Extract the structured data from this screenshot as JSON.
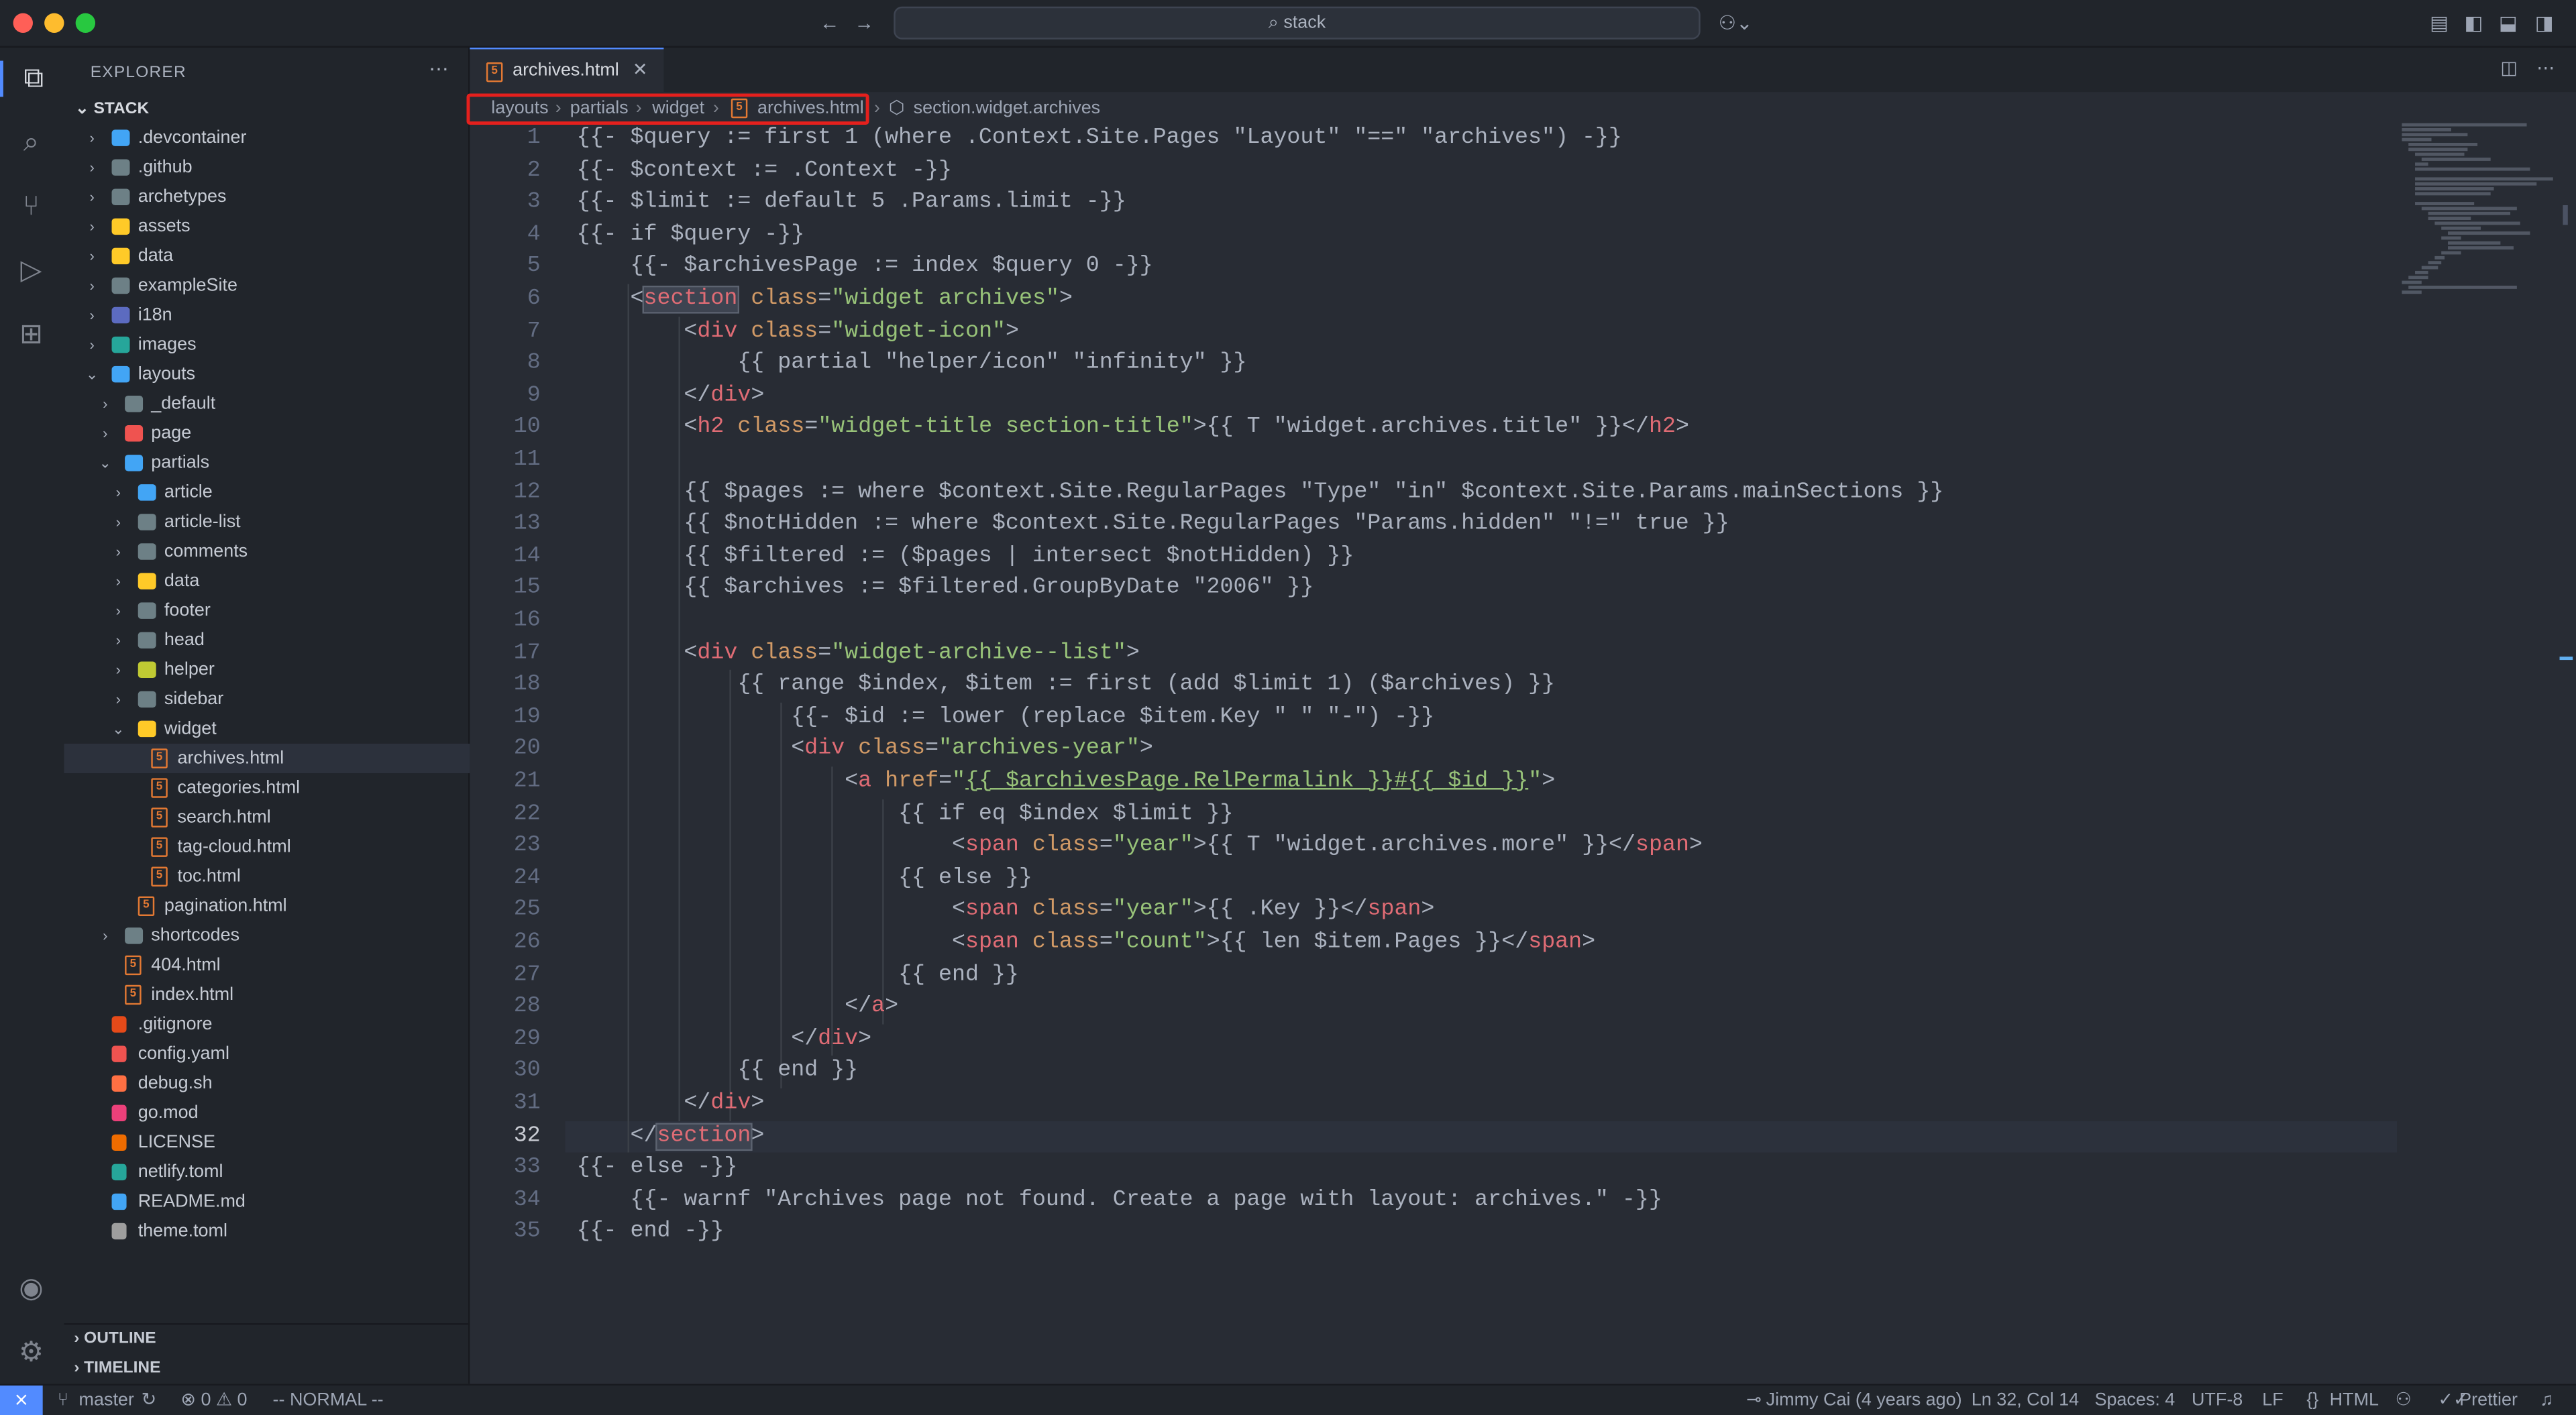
{
  "window": {
    "search_text": "stack"
  },
  "sidebar": {
    "explorer_title": "EXPLORER",
    "root_label": "STACK",
    "outline_label": "OUTLINE",
    "timeline_label": "TIMELINE",
    "tree": [
      {
        "label": ".devcontainer",
        "kind": "folder",
        "depth": 1,
        "chevron": "›",
        "color": "#42a5f5"
      },
      {
        "label": ".github",
        "kind": "folder",
        "depth": 1,
        "chevron": "›",
        "color": "#6d8086"
      },
      {
        "label": "archetypes",
        "kind": "folder",
        "depth": 1,
        "chevron": "›",
        "color": "#6d8086"
      },
      {
        "label": "assets",
        "kind": "folder",
        "depth": 1,
        "chevron": "›",
        "color": "#ffca28"
      },
      {
        "label": "data",
        "kind": "folder",
        "depth": 1,
        "chevron": "›",
        "color": "#ffca28"
      },
      {
        "label": "exampleSite",
        "kind": "folder",
        "depth": 1,
        "chevron": "›",
        "color": "#6d8086"
      },
      {
        "label": "i18n",
        "kind": "folder",
        "depth": 1,
        "chevron": "›",
        "color": "#5c6bc0"
      },
      {
        "label": "images",
        "kind": "folder",
        "depth": 1,
        "chevron": "›",
        "color": "#26a69a"
      },
      {
        "label": "layouts",
        "kind": "folder",
        "depth": 1,
        "chevron": "⌄",
        "color": "#42a5f5"
      },
      {
        "label": "_default",
        "kind": "folder",
        "depth": 2,
        "chevron": "›",
        "color": "#6d8086"
      },
      {
        "label": "page",
        "kind": "folder",
        "depth": 2,
        "chevron": "›",
        "color": "#ef5350"
      },
      {
        "label": "partials",
        "kind": "folder",
        "depth": 2,
        "chevron": "⌄",
        "color": "#42a5f5"
      },
      {
        "label": "article",
        "kind": "folder",
        "depth": 3,
        "chevron": "›",
        "color": "#42a5f5"
      },
      {
        "label": "article-list",
        "kind": "folder",
        "depth": 3,
        "chevron": "›",
        "color": "#6d8086"
      },
      {
        "label": "comments",
        "kind": "folder",
        "depth": 3,
        "chevron": "›",
        "color": "#6d8086"
      },
      {
        "label": "data",
        "kind": "folder",
        "depth": 3,
        "chevron": "›",
        "color": "#ffca28"
      },
      {
        "label": "footer",
        "kind": "folder",
        "depth": 3,
        "chevron": "›",
        "color": "#6d8086"
      },
      {
        "label": "head",
        "kind": "folder",
        "depth": 3,
        "chevron": "›",
        "color": "#6d8086"
      },
      {
        "label": "helper",
        "kind": "folder",
        "depth": 3,
        "chevron": "›",
        "color": "#c0ca33"
      },
      {
        "label": "sidebar",
        "kind": "folder",
        "depth": 3,
        "chevron": "›",
        "color": "#6d8086"
      },
      {
        "label": "widget",
        "kind": "folder",
        "depth": 3,
        "chevron": "⌄",
        "color": "#ffca28"
      },
      {
        "label": "archives.html",
        "kind": "html",
        "depth": 4,
        "chevron": "",
        "color": "#e37933"
      },
      {
        "label": "categories.html",
        "kind": "html",
        "depth": 4,
        "chevron": "",
        "color": "#e37933"
      },
      {
        "label": "search.html",
        "kind": "html",
        "depth": 4,
        "chevron": "",
        "color": "#e37933"
      },
      {
        "label": "tag-cloud.html",
        "kind": "html",
        "depth": 4,
        "chevron": "",
        "color": "#e37933"
      },
      {
        "label": "toc.html",
        "kind": "html",
        "depth": 4,
        "chevron": "",
        "color": "#e37933"
      },
      {
        "label": "pagination.html",
        "kind": "html",
        "depth": 3,
        "chevron": "",
        "color": "#e37933"
      },
      {
        "label": "shortcodes",
        "kind": "folder",
        "depth": 2,
        "chevron": "›",
        "color": "#6d8086"
      },
      {
        "label": "404.html",
        "kind": "html",
        "depth": 2,
        "chevron": "",
        "color": "#e37933"
      },
      {
        "label": "index.html",
        "kind": "html",
        "depth": 2,
        "chevron": "",
        "color": "#e37933"
      },
      {
        "label": ".gitignore",
        "kind": "file",
        "depth": 1,
        "chevron": "",
        "color": "#e64a19"
      },
      {
        "label": "config.yaml",
        "kind": "file",
        "depth": 1,
        "chevron": "",
        "color": "#ef5350"
      },
      {
        "label": "debug.sh",
        "kind": "file",
        "depth": 1,
        "chevron": "",
        "color": "#ff7043"
      },
      {
        "label": "go.mod",
        "kind": "file",
        "depth": 1,
        "chevron": "",
        "color": "#ec407a"
      },
      {
        "label": "LICENSE",
        "kind": "file",
        "depth": 1,
        "chevron": "",
        "color": "#ef6c00"
      },
      {
        "label": "netlify.toml",
        "kind": "file",
        "depth": 1,
        "chevron": "",
        "color": "#26a69a"
      },
      {
        "label": "README.md",
        "kind": "file",
        "depth": 1,
        "chevron": "",
        "color": "#42a5f5"
      },
      {
        "label": "theme.toml",
        "kind": "file",
        "depth": 1,
        "chevron": "",
        "color": "#9e9e9e"
      }
    ]
  },
  "editor": {
    "tab_label": "archives.html",
    "breadcrumb": [
      "layouts",
      "partials",
      "widget",
      "archives.html",
      "section.widget.archives"
    ],
    "current_line": 32,
    "lines": [
      "{{- $query := first 1 (where .Context.Site.Pages \"Layout\" \"==\" \"archives\") -}}",
      "{{- $context := .Context -}}",
      "{{- $limit := default 5 .Params.limit -}}",
      "{{- if $query -}}",
      "    {{- $archivesPage := index $query 0 -}}",
      "    <section class=\"widget archives\">",
      "        <div class=\"widget-icon\">",
      "            {{ partial \"helper/icon\" \"infinity\" }}",
      "        </div>",
      "        <h2 class=\"widget-title section-title\">{{ T \"widget.archives.title\" }}</h2>",
      "",
      "        {{ $pages := where $context.Site.RegularPages \"Type\" \"in\" $context.Site.Params.mainSections }}",
      "        {{ $notHidden := where $context.Site.RegularPages \"Params.hidden\" \"!=\" true }}",
      "        {{ $filtered := ($pages | intersect $notHidden) }}",
      "        {{ $archives := $filtered.GroupByDate \"2006\" }}",
      "",
      "        <div class=\"widget-archive--list\">",
      "            {{ range $index, $item := first (add $limit 1) ($archives) }}",
      "                {{- $id := lower (replace $item.Key \" \" \"-\") -}}",
      "                <div class=\"archives-year\">",
      "                    <a href=\"{{ $archivesPage.RelPermalink }}#{{ $id }}\">",
      "                        {{ if eq $index $limit }}",
      "                            <span class=\"year\">{{ T \"widget.archives.more\" }}</span>",
      "                        {{ else }}",
      "                            <span class=\"year\">{{ .Key }}</span>",
      "                            <span class=\"count\">{{ len $item.Pages }}</span>",
      "                        {{ end }}",
      "                    </a>",
      "                </div>",
      "            {{ end }}",
      "        </div>",
      "    </section>",
      "{{- else -}}",
      "    {{- warnf \"Archives page not found. Create a page with layout: archives.\" -}}",
      "{{- end -}}"
    ]
  },
  "status": {
    "branch": "master",
    "problems": "⊗ 0 ⚠ 0",
    "mode": "-- NORMAL --",
    "blame": "Jimmy Cai (4 years ago)",
    "position": "Ln 32, Col 14",
    "spaces": "Spaces: 4",
    "encoding": "UTF-8",
    "eol": "LF",
    "language": "HTML",
    "formatter": "Prettier"
  }
}
